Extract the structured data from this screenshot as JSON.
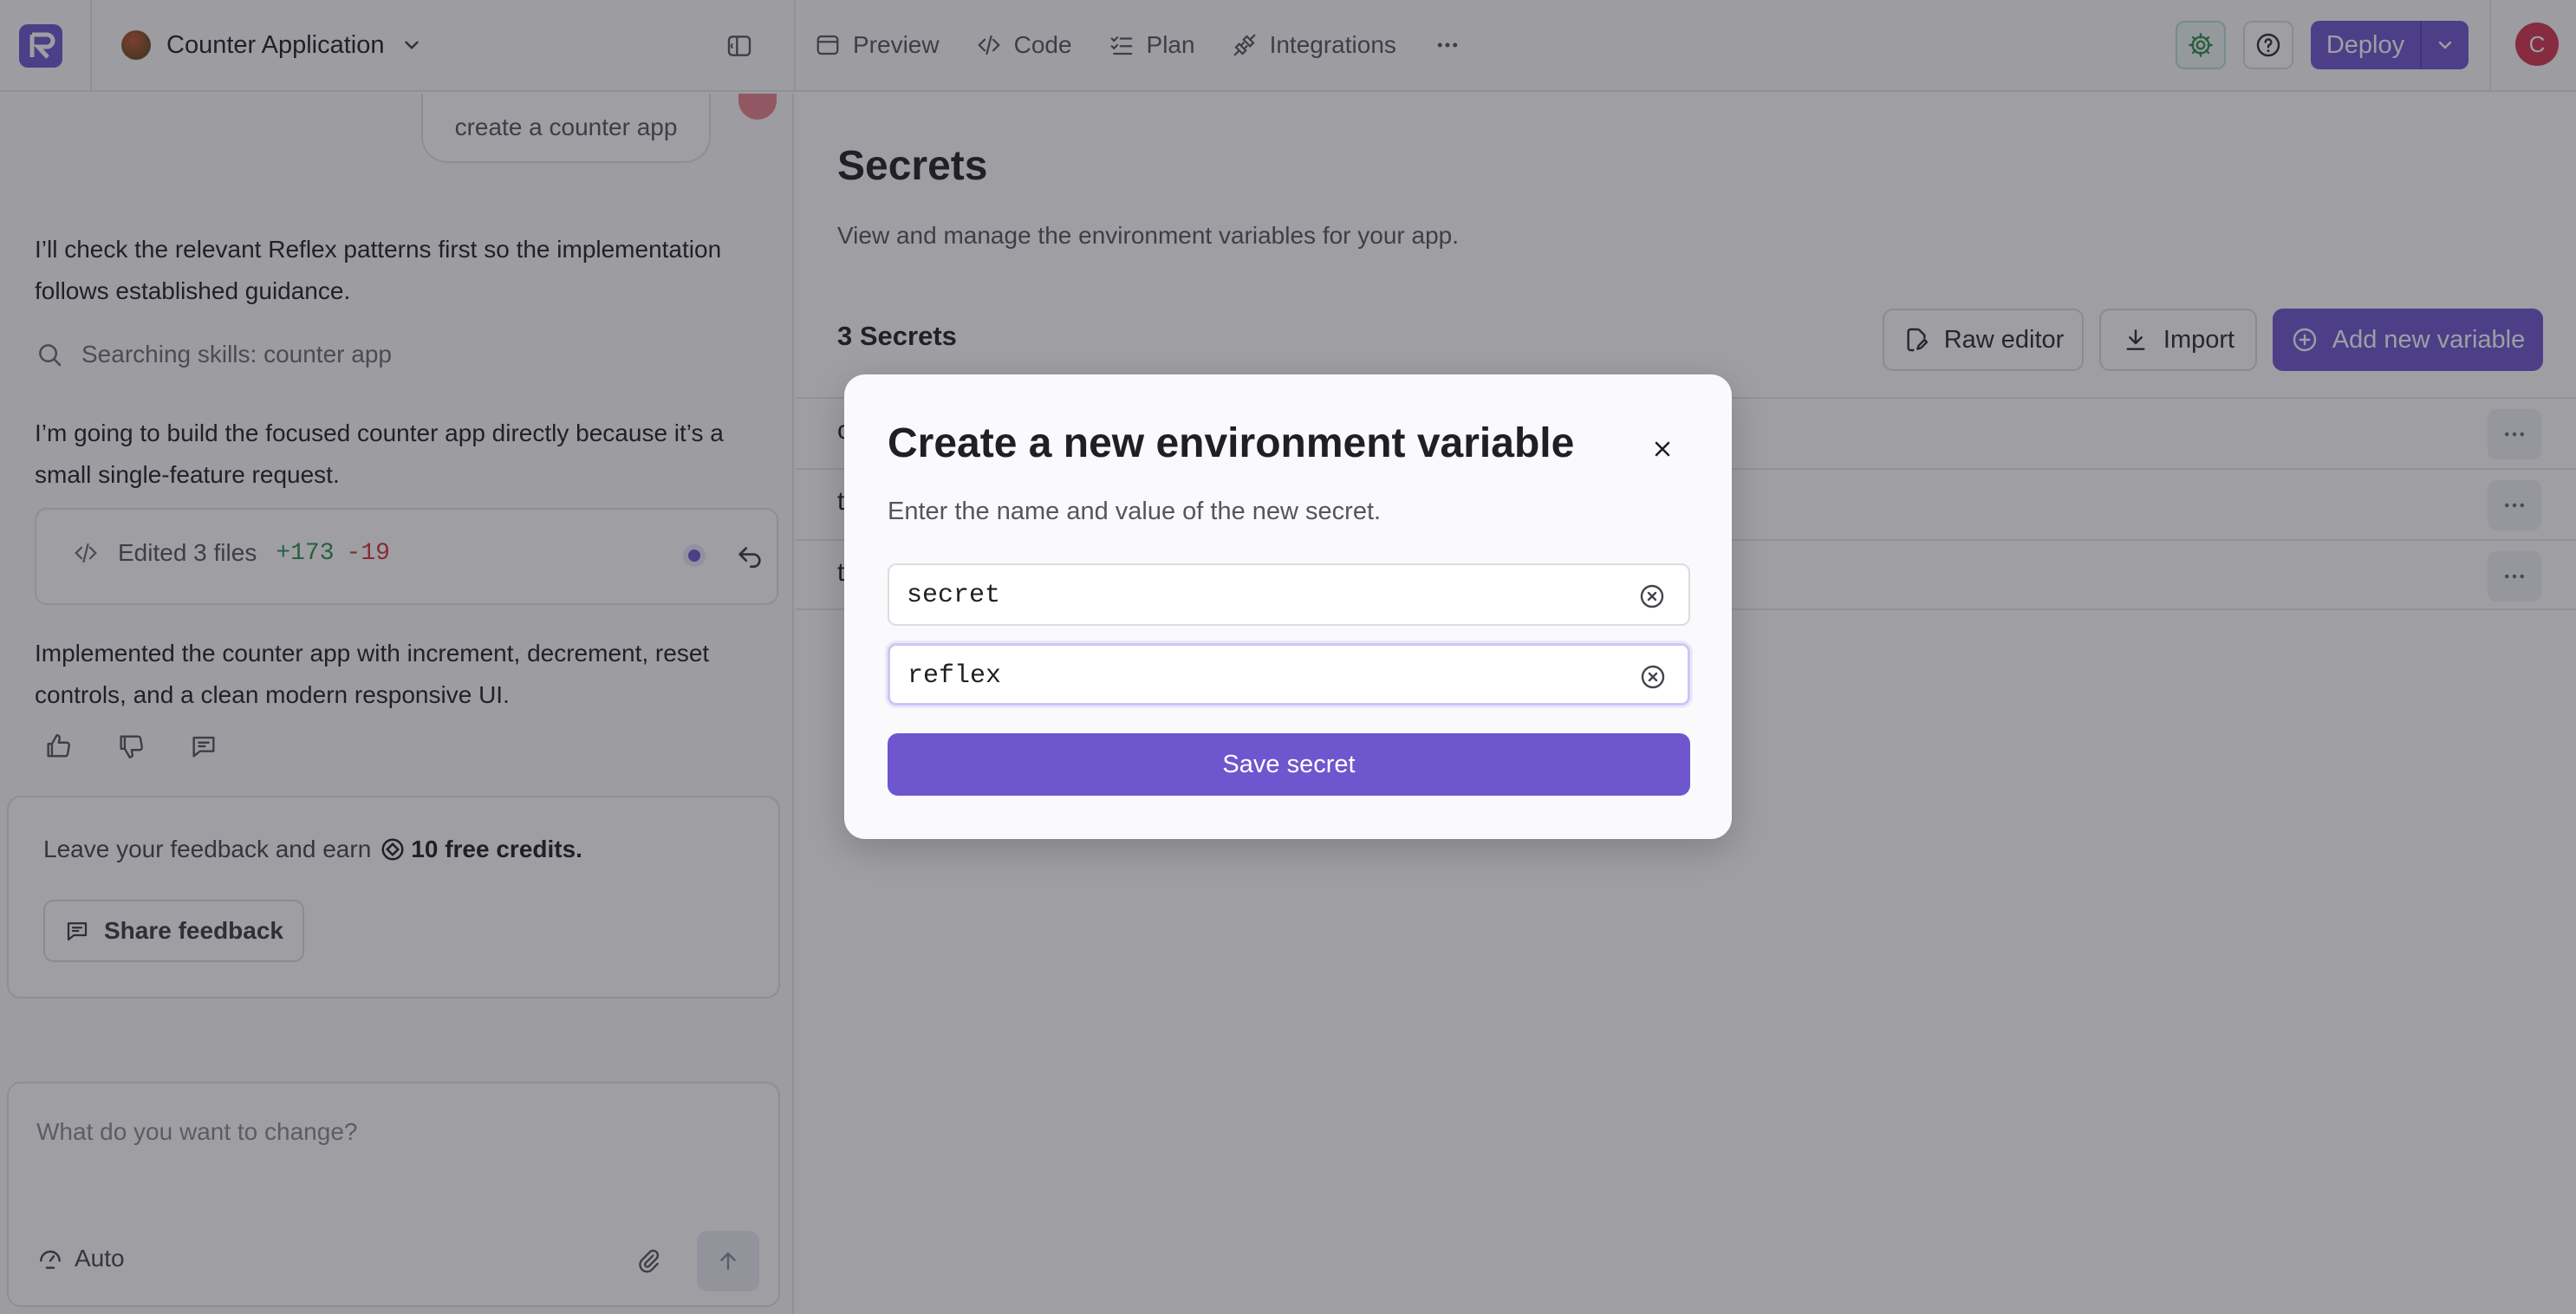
{
  "topbar": {
    "project_name": "Counter Application",
    "tabs": [
      {
        "label": "Preview",
        "icon": "preview-icon"
      },
      {
        "label": "Code",
        "icon": "code-icon"
      },
      {
        "label": "Plan",
        "icon": "plan-icon"
      },
      {
        "label": "Integrations",
        "icon": "integrations-icon"
      }
    ],
    "deploy_label": "Deploy",
    "avatar_initial": "C"
  },
  "chat": {
    "user_message": "create a counter app",
    "assistant_msg_1": "I’ll check the relevant Reflex patterns first so the implementation follows established guidance.",
    "search_status": "Searching skills: counter app",
    "assistant_msg_2": "I’m going to build the focused counter app directly because it’s a small single-feature request.",
    "edited": {
      "label": "Edited 3 files",
      "added": "+173",
      "removed": "-19"
    },
    "assistant_msg_3": "Implemented the counter app with increment, decrement, reset controls, and a clean modern responsive UI.",
    "feedback": {
      "text": "Leave your feedback and earn",
      "credits": "10 free credits.",
      "button": "Share feedback"
    },
    "composer": {
      "placeholder": "What do you want to change?",
      "mode": "Auto"
    }
  },
  "secrets": {
    "title": "Secrets",
    "description": "View and manage the environment variables for your app.",
    "count_label": "3 Secrets",
    "raw_editor": "Raw editor",
    "import": "Import",
    "add_new": "Add new variable",
    "rows": [
      {
        "key": "c"
      },
      {
        "key": "t"
      },
      {
        "key": "t"
      }
    ]
  },
  "modal": {
    "title": "Create a new environment variable",
    "description": "Enter the name and value of the new secret.",
    "name_value": "secret",
    "value_value": "reflex",
    "save_label": "Save secret"
  },
  "colors": {
    "accent": "#6e56cf",
    "added": "#2f8f4e",
    "removed": "#d0353f",
    "avatar": "#d5334f"
  }
}
